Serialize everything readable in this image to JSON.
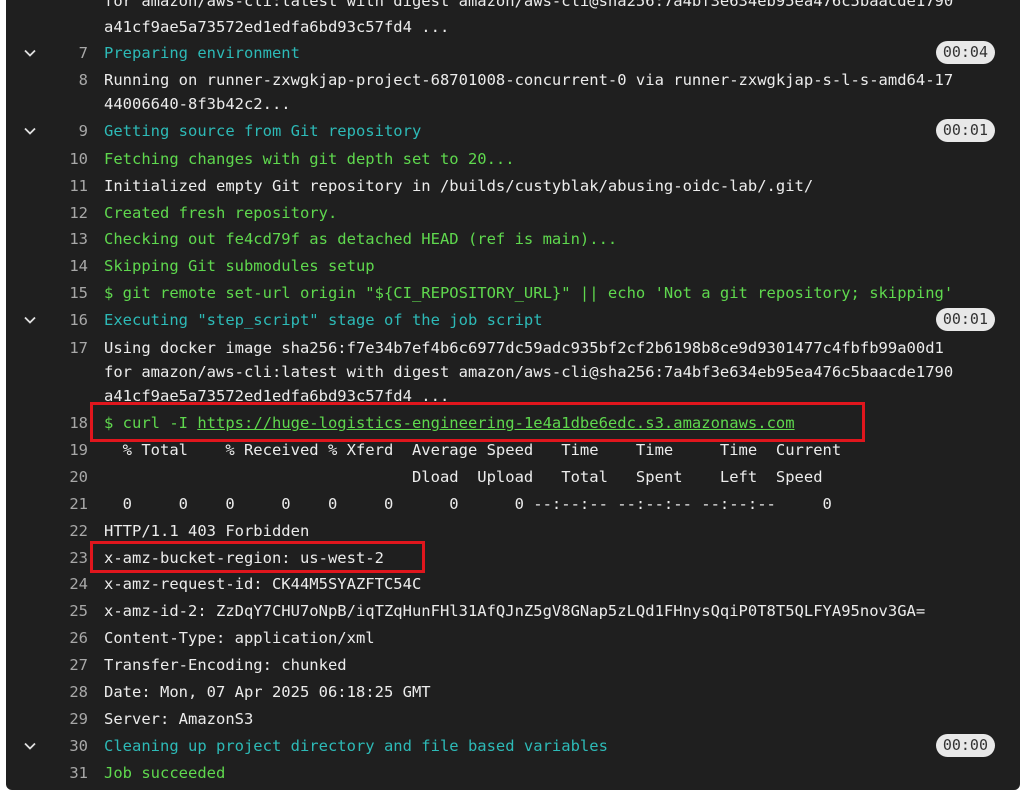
{
  "log": {
    "line0_top": "for amazon/aws-cli:latest with digest amazon/aws-cli@sha256:7a4bf3e634eb95ea476c5baacde1790",
    "line0": "a41cf9ae5a73572ed1edfa6bd93c57fd4 ...",
    "l7": {
      "num": "7",
      "text": "Preparing environment",
      "duration": "00:04"
    },
    "l8": {
      "num": "8",
      "text": "Running on runner-zxwgkjap-project-68701008-concurrent-0 via runner-zxwgkjap-s-l-s-amd64-17\n44006640-8f3b42c2..."
    },
    "l9": {
      "num": "9",
      "text": "Getting source from Git repository",
      "duration": "00:01"
    },
    "l10": {
      "num": "10",
      "text": "Fetching changes with git depth set to 20..."
    },
    "l11": {
      "num": "11",
      "text": "Initialized empty Git repository in /builds/custyblak/abusing-oidc-lab/.git/"
    },
    "l12": {
      "num": "12",
      "text": "Created fresh repository."
    },
    "l13": {
      "num": "13",
      "text": "Checking out fe4cd79f as detached HEAD (ref is main)..."
    },
    "l14": {
      "num": "14",
      "text": "Skipping Git submodules setup"
    },
    "l15": {
      "num": "15",
      "text": "$ git remote set-url origin \"${CI_REPOSITORY_URL}\" || echo 'Not a git repository; skipping'"
    },
    "l16": {
      "num": "16",
      "text": "Executing \"step_script\" stage of the job script",
      "duration": "00:01"
    },
    "l17": {
      "num": "17",
      "text": "Using docker image sha256:f7e34b7ef4b6c6977dc59adc935bf2cf2b6198b8ce9d9301477c4fbfb99a00d1\nfor amazon/aws-cli:latest with digest amazon/aws-cli@sha256:7a4bf3e634eb95ea476c5baacde1790\na41cf9ae5a73572ed1edfa6bd93c57fd4 ..."
    },
    "l18": {
      "num": "18",
      "prefix": "$ curl -I ",
      "url": "https://huge-logistics-engineering-1e4a1dbe6edc.s3.amazonaws.com"
    },
    "l19": {
      "num": "19",
      "text": "  % Total    % Received % Xferd  Average Speed   Time    Time     Time  Current"
    },
    "l20": {
      "num": "20",
      "text": "                                 Dload  Upload   Total   Spent    Left  Speed"
    },
    "l21": {
      "num": "21",
      "text": "  0     0    0     0    0     0      0      0 --:--:-- --:--:-- --:--:--     0"
    },
    "l22": {
      "num": "22",
      "text": "HTTP/1.1 403 Forbidden"
    },
    "l23": {
      "num": "23",
      "text": "x-amz-bucket-region: us-west-2"
    },
    "l24": {
      "num": "24",
      "text": "x-amz-request-id: CK44M5SYAZFTC54C"
    },
    "l25": {
      "num": "25",
      "text": "x-amz-id-2: ZzDqY7CHU7oNpB/iqTZqHunFHl31AfQJnZ5gV8GNap5zLQd1FHnysQqiP0T8T5QLFYA95nov3GA="
    },
    "l26": {
      "num": "26",
      "text": "Content-Type: application/xml"
    },
    "l27": {
      "num": "27",
      "text": "Transfer-Encoding: chunked"
    },
    "l28": {
      "num": "28",
      "text": "Date: Mon, 07 Apr 2025 06:18:25 GMT"
    },
    "l29": {
      "num": "29",
      "text": "Server: AmazonS3"
    },
    "l30": {
      "num": "30",
      "text": "Cleaning up project directory and file based variables",
      "duration": "00:00"
    },
    "l31": {
      "num": "31",
      "text": "Job succeeded"
    }
  },
  "colors": {
    "section": "#2dbab7",
    "success": "#5fd84e",
    "plain": "#ececec",
    "highlight": "#e0161d"
  },
  "icons": {
    "collapse": "chevron-down-icon"
  }
}
